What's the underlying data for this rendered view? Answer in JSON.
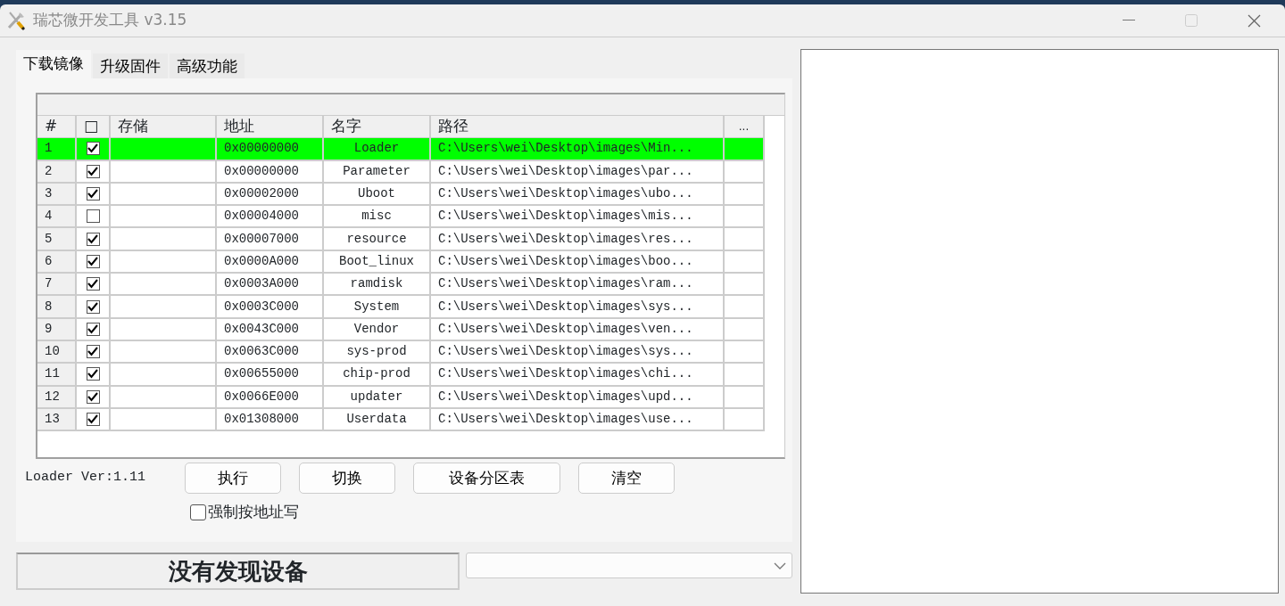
{
  "window": {
    "title": "瑞芯微开发工具 v3.15"
  },
  "tabs": [
    {
      "label": "下载镜像",
      "selected": true
    },
    {
      "label": "升级固件",
      "selected": false
    },
    {
      "label": "高级功能",
      "selected": false
    }
  ],
  "table": {
    "columns": [
      "#",
      "□",
      "存储",
      "地址",
      "名字",
      "路径",
      "..."
    ],
    "rows": [
      {
        "index": "1",
        "checked": true,
        "selected": true,
        "address": "0x00000000",
        "name": "Loader",
        "path": "C:\\Users\\wei\\Desktop\\images\\Min..."
      },
      {
        "index": "2",
        "checked": true,
        "selected": false,
        "address": "0x00000000",
        "name": "Parameter",
        "path": "C:\\Users\\wei\\Desktop\\images\\par..."
      },
      {
        "index": "3",
        "checked": true,
        "selected": false,
        "address": "0x00002000",
        "name": "Uboot",
        "path": "C:\\Users\\wei\\Desktop\\images\\ubo..."
      },
      {
        "index": "4",
        "checked": false,
        "selected": false,
        "address": "0x00004000",
        "name": "misc",
        "path": "C:\\Users\\wei\\Desktop\\images\\mis..."
      },
      {
        "index": "5",
        "checked": true,
        "selected": false,
        "address": "0x00007000",
        "name": "resource",
        "path": "C:\\Users\\wei\\Desktop\\images\\res..."
      },
      {
        "index": "6",
        "checked": true,
        "selected": false,
        "address": "0x0000A000",
        "name": "Boot_linux",
        "path": "C:\\Users\\wei\\Desktop\\images\\boo..."
      },
      {
        "index": "7",
        "checked": true,
        "selected": false,
        "address": "0x0003A000",
        "name": "ramdisk",
        "path": "C:\\Users\\wei\\Desktop\\images\\ram..."
      },
      {
        "index": "8",
        "checked": true,
        "selected": false,
        "address": "0x0003C000",
        "name": "System",
        "path": "C:\\Users\\wei\\Desktop\\images\\sys..."
      },
      {
        "index": "9",
        "checked": true,
        "selected": false,
        "address": "0x0043C000",
        "name": "Vendor",
        "path": "C:\\Users\\wei\\Desktop\\images\\ven..."
      },
      {
        "index": "10",
        "checked": true,
        "selected": false,
        "address": "0x0063C000",
        "name": "sys-prod",
        "path": "C:\\Users\\wei\\Desktop\\images\\sys..."
      },
      {
        "index": "11",
        "checked": true,
        "selected": false,
        "address": "0x00655000",
        "name": "chip-prod",
        "path": "C:\\Users\\wei\\Desktop\\images\\chi..."
      },
      {
        "index": "12",
        "checked": true,
        "selected": false,
        "address": "0x0066E000",
        "name": "updater",
        "path": "C:\\Users\\wei\\Desktop\\images\\upd..."
      },
      {
        "index": "13",
        "checked": true,
        "selected": false,
        "address": "0x01308000",
        "name": "Userdata",
        "path": "C:\\Users\\wei\\Desktop\\images\\use..."
      }
    ]
  },
  "loader_version": "Loader Ver:1.11",
  "buttons": [
    "执行",
    "切换",
    "设备分区表",
    "清空"
  ],
  "force_address": {
    "label": "强制按地址写",
    "checked": false
  },
  "status": "没有发现设备"
}
